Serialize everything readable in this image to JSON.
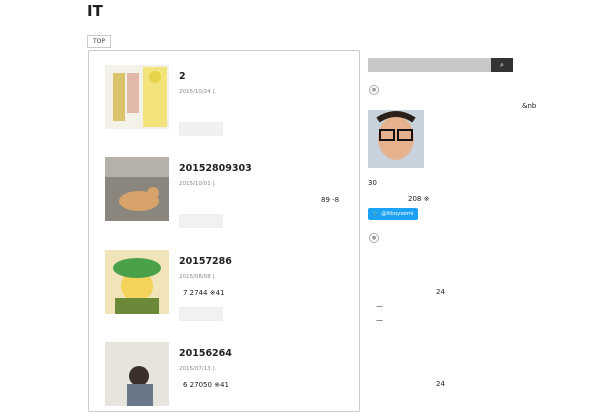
{
  "header": {
    "site_title": "IT"
  },
  "breadcrumb": {
    "top": "TOP"
  },
  "posts": [
    {
      "title": "2",
      "date": "2015/10/24 |.",
      "excerpt": ""
    },
    {
      "title": "20152809303",
      "date": "2015/10/01 |.",
      "excerpt": "89 -8"
    },
    {
      "title": "20157286",
      "date": "2015/08/08 |.",
      "excerpt": "7 2744 ※41"
    },
    {
      "title": "20156264",
      "date": "2015/07/13 |.",
      "excerpt": "6 27050 ※41"
    }
  ],
  "sidebar": {
    "search_icon": "⌕",
    "nb_text": "&nb",
    "thirty": "30",
    "count": "208 ※",
    "twitter_label": "@itboysemi",
    "twentyfour_1": "24",
    "dash_1": "—",
    "dash_2": "—",
    "twentyfour_2": "24"
  }
}
